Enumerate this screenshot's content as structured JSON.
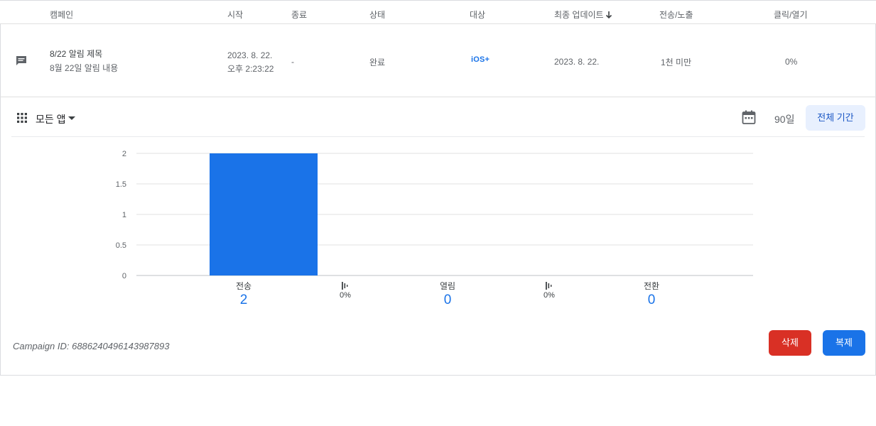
{
  "table": {
    "headers": {
      "campaign": "캠페인",
      "start": "시작",
      "end": "종료",
      "status": "상태",
      "target": "대상",
      "last_update": "최종 업데이트",
      "sent": "전송/노출",
      "click": "클릭/열기"
    },
    "row": {
      "icon": "message-icon",
      "title": "8/22 알림 제목",
      "body": "8월 22일 알림 내용",
      "start_date": "2023. 8. 22.",
      "start_time": "오후 2:23:22",
      "end": "-",
      "status": "완료",
      "target": "iOS+",
      "last_update": "2023. 8. 22.",
      "sent": "1천 미만",
      "click": "0%"
    }
  },
  "toolbar": {
    "apps_label": "모든 앱",
    "days_label": "90일",
    "period_button": "전체 기간"
  },
  "chart_data": {
    "type": "bar",
    "categories": [
      "전송",
      "열림",
      "전환"
    ],
    "values": [
      2,
      0,
      0
    ],
    "ylim": [
      0,
      2
    ],
    "yticks": [
      "0",
      "0.5",
      "1",
      "1.5",
      "2"
    ],
    "grid": true,
    "bar_color": "#1a73e8"
  },
  "stats": {
    "items": [
      {
        "label": "전송",
        "value": "2"
      },
      {
        "label": "열림",
        "value": "0"
      },
      {
        "label": "전환",
        "value": "0"
      }
    ],
    "rates": [
      "0%",
      "0%"
    ]
  },
  "footer": {
    "campaign_id": "Campaign ID: 6886240496143987893",
    "delete_label": "삭제",
    "copy_label": "복제"
  },
  "colors": {
    "accent": "#1a73e8",
    "danger": "#d93025"
  }
}
